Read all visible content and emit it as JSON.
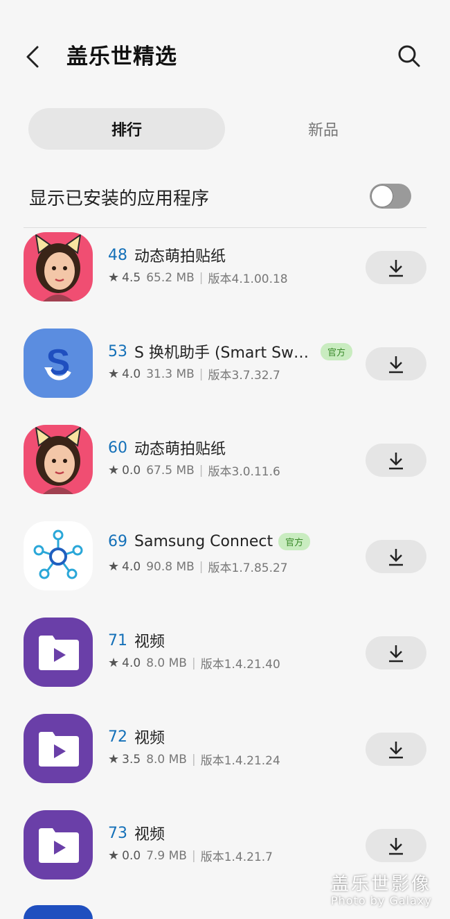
{
  "header": {
    "title": "盖乐世精选",
    "back_icon": "back-arrow-icon",
    "search_icon": "search-icon"
  },
  "tabs": [
    {
      "label": "排行",
      "active": true
    },
    {
      "label": "新品",
      "active": false
    }
  ],
  "toggle": {
    "label": "显示已安装的应用程序",
    "on": false
  },
  "apps": [
    {
      "rank": "48",
      "name": "动态萌拍贴纸",
      "badge": "",
      "rating": "4.5",
      "size": "65.2 MB",
      "version": "版本4.1.00.18"
    },
    {
      "rank": "53",
      "name": "S 换机助手 (Smart Switch)",
      "badge": "官方",
      "rating": "4.0",
      "size": "31.3 MB",
      "version": "版本3.7.32.7"
    },
    {
      "rank": "60",
      "name": "动态萌拍贴纸",
      "badge": "",
      "rating": "0.0",
      "size": "67.5 MB",
      "version": "版本3.0.11.6"
    },
    {
      "rank": "69",
      "name": "Samsung Connect",
      "badge": "官方",
      "rating": "4.0",
      "size": "90.8 MB",
      "version": "版本1.7.85.27"
    },
    {
      "rank": "71",
      "name": "视频",
      "badge": "",
      "rating": "4.0",
      "size": "8.0 MB",
      "version": "版本1.4.21.40"
    },
    {
      "rank": "72",
      "name": "视频",
      "badge": "",
      "rating": "3.5",
      "size": "8.0 MB",
      "version": "版本1.4.21.24"
    },
    {
      "rank": "73",
      "name": "视频",
      "badge": "",
      "rating": "0.0",
      "size": "7.9 MB",
      "version": "版本1.4.21.7"
    }
  ],
  "watermark": {
    "title": "盖乐世影像",
    "subtitle": "Photo by Galaxy"
  },
  "colors": {
    "rank": "#1470b8",
    "badge_bg": "#c9ecc0",
    "badge_text": "#3a8a2a",
    "accent_blue": "#5b8de0",
    "video_purple": "#6a3fa8"
  }
}
